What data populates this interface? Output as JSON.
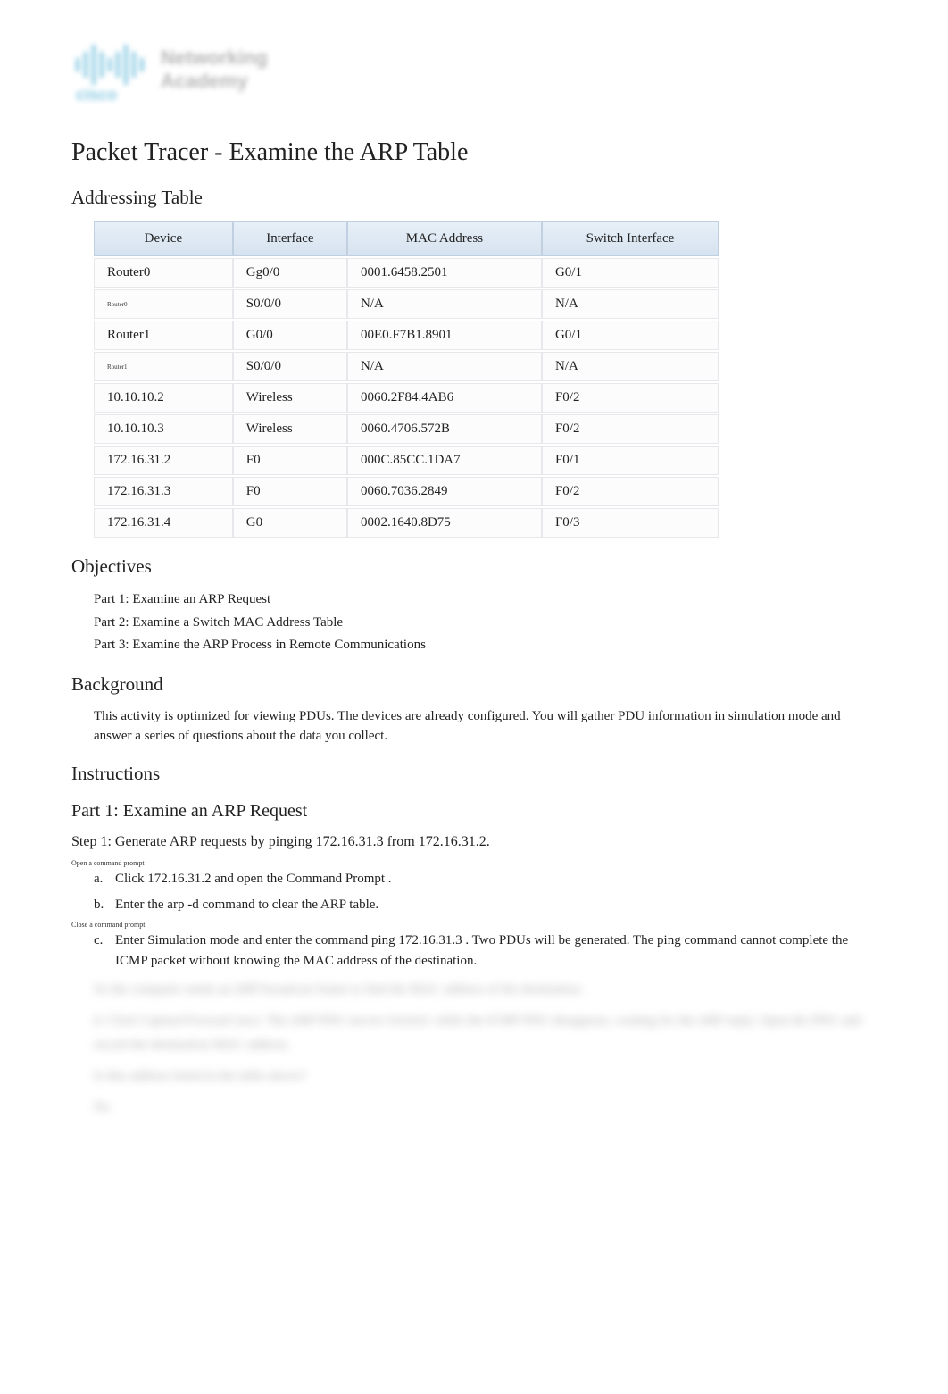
{
  "logo": {
    "brand_top": "Networking",
    "brand_bottom": "Academy",
    "cisco_label": "cisco"
  },
  "title": "Packet Tracer - Examine the ARP Table",
  "addressing": {
    "heading": "Addressing Table",
    "headers": [
      "Device",
      "Interface",
      "MAC Address",
      "Switch Interface"
    ],
    "rows": [
      {
        "device": "Router0",
        "interface": "Gg0/0",
        "mac": "0001.6458.2501",
        "swint": "G0/1"
      },
      {
        "device": "Router0",
        "small": true,
        "interface": "S0/0/0",
        "mac": "N/A",
        "swint": "N/A"
      },
      {
        "device": "Router1",
        "interface": "G0/0",
        "mac": "00E0.F7B1.8901",
        "swint": "G0/1"
      },
      {
        "device": "Router1",
        "small": true,
        "interface": "S0/0/0",
        "mac": "N/A",
        "swint": "N/A"
      },
      {
        "device": "10.10.10.2",
        "interface": "Wireless",
        "mac": "0060.2F84.4AB6",
        "swint": "F0/2"
      },
      {
        "device": "10.10.10.3",
        "interface": "Wireless",
        "mac": "0060.4706.572B",
        "swint": "F0/2"
      },
      {
        "device": "172.16.31.2",
        "interface": "F0",
        "mac": "000C.85CC.1DA7",
        "swint": "F0/1"
      },
      {
        "device": "172.16.31.3",
        "interface": "F0",
        "mac": "0060.7036.2849",
        "swint": "F0/2"
      },
      {
        "device": "172.16.31.4",
        "interface": "G0",
        "mac": "0002.1640.8D75",
        "swint": "F0/3"
      }
    ]
  },
  "objectives": {
    "heading": "Objectives",
    "items": [
      "Part 1: Examine an ARP Request",
      "Part 2: Examine a Switch MAC Address Table",
      "Part 3: Examine the ARP Process in Remote Communications"
    ]
  },
  "background": {
    "heading": "Background",
    "text": "This activity is optimized for viewing PDUs. The devices are already configured. You will gather PDU information in simulation mode and answer a series of questions about the data you collect."
  },
  "instructions": {
    "heading": "Instructions"
  },
  "part1": {
    "heading": "Part 1: Examine an ARP Request",
    "step1": {
      "heading": "Step 1: Generate ARP requests by pinging 172.16.31.3 from 172.16.31.2.",
      "note_open": "Open a command prompt",
      "a": "Click  172.16.31.2   and open the    Command Prompt    .",
      "b": "Enter  the   arp -d   command to clear the ARP table.",
      "note_close": "Close a command prompt",
      "c": "Enter  Simulation    mode and enter the command      ping 172.16.31.3    . Two PDUs will be generated. The ping   command cannot complete the ICMP packet without knowing the MAC address of the destination."
    }
  },
  "blurred": {
    "l1": "So the computer sends an ARP broadcast frame to find the MAC address of the destination.",
    "l2": "d.   Click Capture/Forward once. The ARP PDU moves Switch1 while the ICMP PDU disappears, waiting for the ARP reply. Open the PDU and record the destination MAC address.",
    "l3": "Is this address listed in the table above?",
    "l4": "No"
  }
}
